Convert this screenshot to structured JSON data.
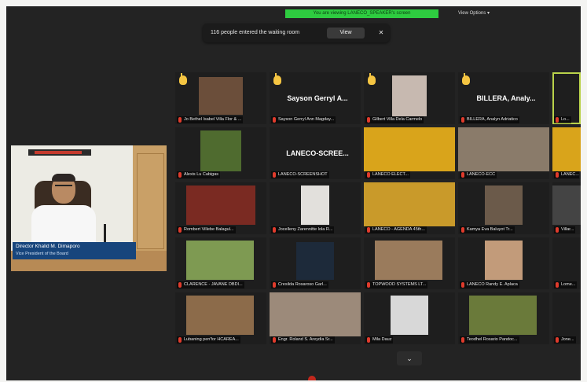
{
  "top_bar": {
    "share_banner": "You are viewing LANECO_SPEAKER's screen",
    "view_options": "View Options ▾"
  },
  "waiting_room": {
    "message": "116 people entered the waiting room",
    "view_label": "View",
    "close_glyph": "✕"
  },
  "speaker": {
    "name": "Director Khalid M. Dimaporo",
    "title": "Vice President of the Board"
  },
  "tiles": [
    {
      "label": "Jo Bethel Isabel Villa Flor & ..."
    },
    {
      "big_name": "Sayson Gerryl A...",
      "label": "Sayson Gerryl Ann Magday..."
    },
    {
      "label": "Gilbert Villa Dela Carmelo"
    },
    {
      "big_name": "BILLERA, Analy...",
      "label": "BILLERA, Analyn Adriatico"
    },
    {
      "label": "Lo..."
    },
    {
      "label": "Alexis Lu Cabigas"
    },
    {
      "big_name": "LANECO-SCREE...",
      "label": "LANECO-SCREENSHOT"
    },
    {
      "label": "LANECO ELECT..."
    },
    {
      "label": "LANECO-ECC"
    },
    {
      "label": "LANEC..."
    },
    {
      "label": "Rombert Villebe Balagul..."
    },
    {
      "label": "Jocelleny Zarennitte lola R..."
    },
    {
      "label": "LANECO - AGENDA 45th..."
    },
    {
      "label": "Kamya Eva Baluyot Tr..."
    },
    {
      "label": "Villar..."
    },
    {
      "label": "CLARENCE - JAVANE DBDI..."
    },
    {
      "label": "Cresilda Rosaroso Garl..."
    },
    {
      "label": "TOPWOOD SYSTEMS LT..."
    },
    {
      "label": "LANECO Randy E. Aplaca"
    },
    {
      "label": "Lome..."
    },
    {
      "label": "Lubaning pen'for HCAREA..."
    },
    {
      "label": "Engr. Roland S. Areydia Sr..."
    },
    {
      "label": "Mila Dauz"
    },
    {
      "label": "Teodhel Rosario Pandoc..."
    },
    {
      "label": "Jone..."
    }
  ],
  "scroll_glyph": "⌄",
  "colors": {
    "background": "#232323",
    "share_banner": "#2ecc40",
    "muted_mic": "#e03b2c",
    "raised_hand": "#f5c542",
    "active_speaker_outline": "#b9d24a",
    "name_plate": "#17457c"
  }
}
